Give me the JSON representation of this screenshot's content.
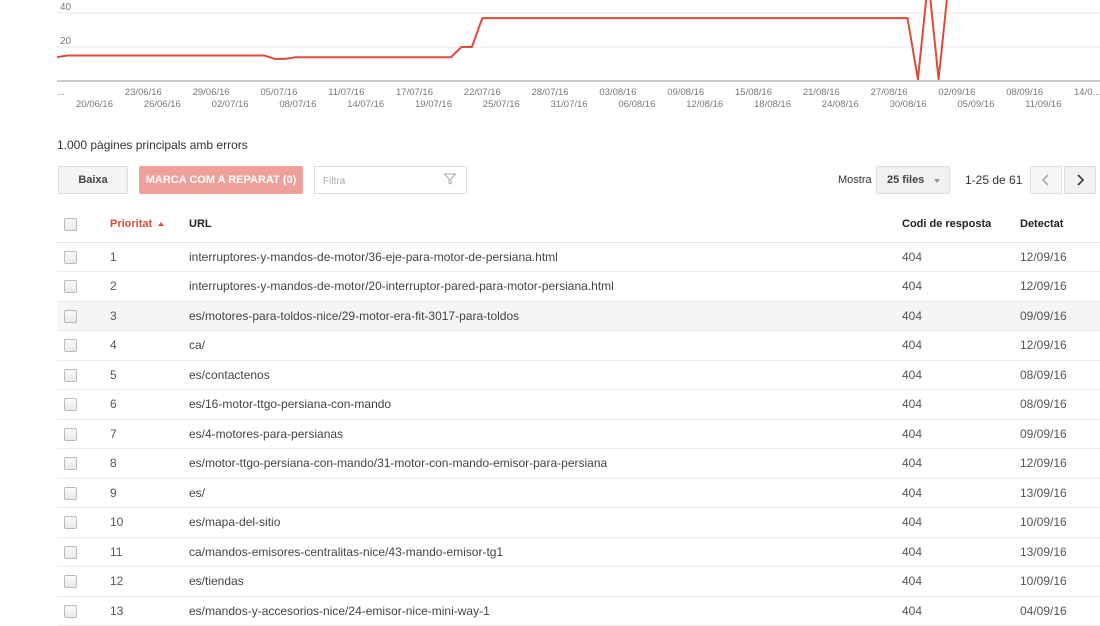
{
  "chart": {
    "y_ticks": [
      "40",
      "20"
    ],
    "dates_top": [
      "...",
      "23/06/16",
      "29/06/16",
      "05/07/16",
      "11/07/16",
      "17/07/16",
      "22/07/16",
      "28/07/16",
      "03/08/16",
      "09/08/16",
      "15/08/16",
      "21/08/16",
      "27/08/16",
      "02/09/16",
      "08/09/16",
      "14/0..."
    ],
    "dates_bottom": [
      "20/06/16",
      "26/06/16",
      "02/07/16",
      "08/07/16",
      "14/07/16",
      "19/07/16",
      "25/07/16",
      "31/07/16",
      "06/08/16",
      "12/08/16",
      "18/08/16",
      "24/08/16",
      "30/08/16",
      "05/09/16",
      "11/09/16"
    ],
    "line_color": "#dd4b39"
  },
  "chart_data": {
    "type": "line",
    "series": [
      {
        "values": [
          14,
          15,
          15,
          15,
          15,
          15,
          15,
          15,
          15,
          15,
          15,
          15,
          15,
          15,
          15,
          15,
          15,
          15,
          15,
          15,
          15,
          13,
          13,
          14,
          14,
          14,
          14,
          14,
          14,
          14,
          14,
          14,
          14,
          14,
          14,
          14,
          14,
          14,
          14,
          20,
          20,
          37,
          37,
          37,
          37,
          37,
          37,
          37,
          37,
          37,
          37,
          37,
          37,
          37,
          37,
          37,
          37,
          37,
          37,
          37,
          37,
          37,
          37,
          37,
          37,
          37,
          37,
          37,
          37,
          37,
          37,
          37,
          37,
          37,
          37,
          37,
          37,
          37,
          37,
          37,
          37,
          37,
          37,
          1,
          60,
          1,
          60
        ]
      }
    ],
    "ylim": [
      0,
      50
    ],
    "yticks": [
      20,
      40
    ],
    "grid": true
  },
  "summary": "1.000 pàgines principals amb errors",
  "toolbar": {
    "download_label": "Baixa",
    "mark_fixed_label": "MARCA COM A REPARAT (0)",
    "filter_placeholder": "Filtra",
    "show_label": "Mostra",
    "rows_value": "25 files",
    "range_text": "1-25 de 61",
    "prev_icon": "chevron-left-icon",
    "next_icon": "chevron-right-icon"
  },
  "table": {
    "headers": {
      "priority": "Prioritat",
      "url": "URL",
      "code": "Codi de resposta",
      "detected": "Detectat"
    },
    "rows": [
      {
        "priority": "1",
        "url": "interruptores-y-mandos-de-motor/36-eje-para-motor-de-persiana.html",
        "code": "404",
        "detected": "12/09/16"
      },
      {
        "priority": "2",
        "url": "interruptores-y-mandos-de-motor/20-interruptor-pared-para-motor-persiana.html",
        "code": "404",
        "detected": "12/09/16"
      },
      {
        "priority": "3",
        "url": "es/motores-para-toldos-nice/29-motor-era-fit-3017-para-toldos",
        "code": "404",
        "detected": "09/09/16"
      },
      {
        "priority": "4",
        "url": "ca/",
        "code": "404",
        "detected": "12/09/16"
      },
      {
        "priority": "5",
        "url": "es/contactenos",
        "code": "404",
        "detected": "08/09/16"
      },
      {
        "priority": "6",
        "url": "es/16-motor-ttgo-persiana-con-mando",
        "code": "404",
        "detected": "08/09/16"
      },
      {
        "priority": "7",
        "url": "es/4-motores-para-persianas",
        "code": "404",
        "detected": "09/09/16"
      },
      {
        "priority": "8",
        "url": "es/motor-ttgo-persiana-con-mando/31-motor-con-mando-emisor-para-persiana",
        "code": "404",
        "detected": "12/09/16"
      },
      {
        "priority": "9",
        "url": "es/",
        "code": "404",
        "detected": "13/09/16"
      },
      {
        "priority": "10",
        "url": "es/mapa-del-sitio",
        "code": "404",
        "detected": "10/09/16"
      },
      {
        "priority": "11",
        "url": "ca/mandos-emisores-centralitas-nice/43-mando-emisor-tg1",
        "code": "404",
        "detected": "13/09/16"
      },
      {
        "priority": "12",
        "url": "es/tiendas",
        "code": "404",
        "detected": "10/09/16"
      },
      {
        "priority": "13",
        "url": "es/mandos-y-accesorios-nice/24-emisor-nice-mini-way-1",
        "code": "404",
        "detected": "04/09/16"
      }
    ]
  }
}
